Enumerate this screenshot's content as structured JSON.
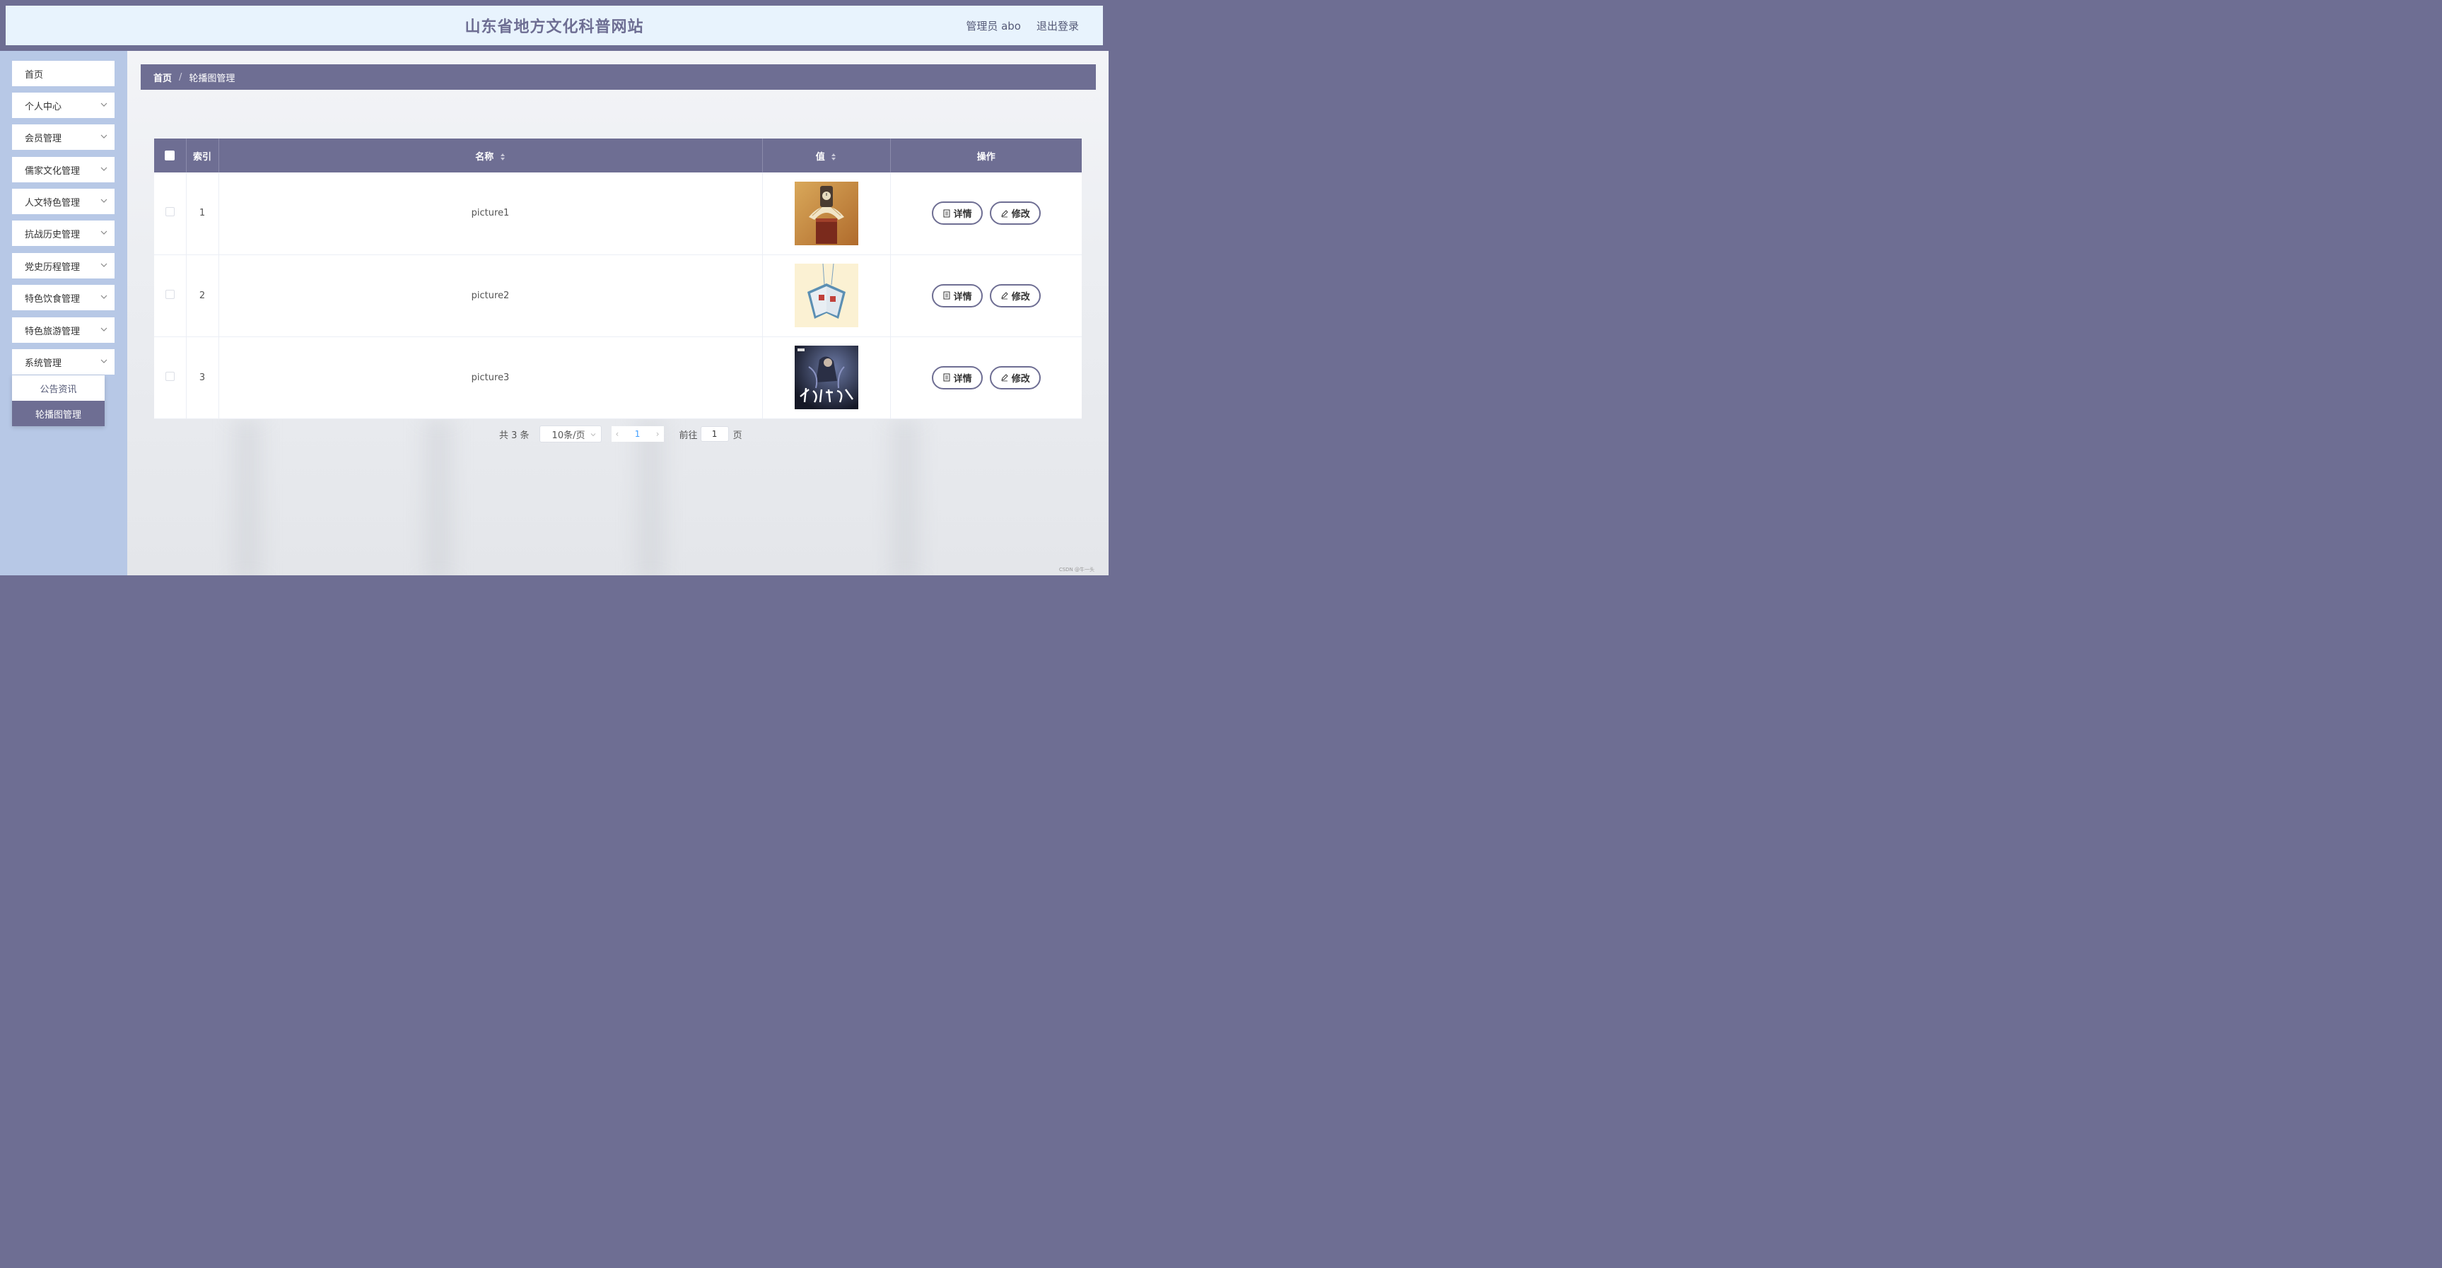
{
  "header": {
    "title": "山东省地方文化科普网站",
    "user_label": "管理员 abo",
    "logout_label": "退出登录"
  },
  "sidebar": {
    "items": [
      {
        "label": "首页",
        "has_children": false
      },
      {
        "label": "个人中心",
        "has_children": true
      },
      {
        "label": "会员管理",
        "has_children": true
      },
      {
        "label": "儒家文化管理",
        "has_children": true
      },
      {
        "label": "人文特色管理",
        "has_children": true
      },
      {
        "label": "抗战历史管理",
        "has_children": true
      },
      {
        "label": "党史历程管理",
        "has_children": true
      },
      {
        "label": "特色饮食管理",
        "has_children": true
      },
      {
        "label": "特色旅游管理",
        "has_children": true
      },
      {
        "label": "系统管理",
        "has_children": true
      }
    ],
    "submenu": [
      {
        "label": "公告资讯",
        "active": false
      },
      {
        "label": "轮播图管理",
        "active": true
      }
    ]
  },
  "breadcrumb": {
    "home": "首页",
    "separator": "/",
    "current": "轮播图管理"
  },
  "table": {
    "columns": {
      "index": "索引",
      "name": "名称",
      "value": "值",
      "actions": "操作"
    },
    "rows": [
      {
        "index": "1",
        "name": "picture1",
        "image": "book-clock-image"
      },
      {
        "index": "2",
        "name": "picture2",
        "image": "open-book-image"
      },
      {
        "index": "3",
        "name": "picture3",
        "image": "xianxia-cover-image"
      }
    ],
    "detail_label": "详情",
    "edit_label": "修改"
  },
  "pagination": {
    "total_text": "共 3 条",
    "page_size": "10条/页",
    "prev": "‹",
    "current_page": "1",
    "next": "›",
    "goto_label": "前往",
    "goto_value": "1",
    "goto_suffix": "页"
  },
  "watermark": "CSDN @牛一头",
  "colors": {
    "primary": "#6e6e93",
    "header_bg": "#e8f3fd",
    "sidebar_bg": "#b7c8e6"
  }
}
